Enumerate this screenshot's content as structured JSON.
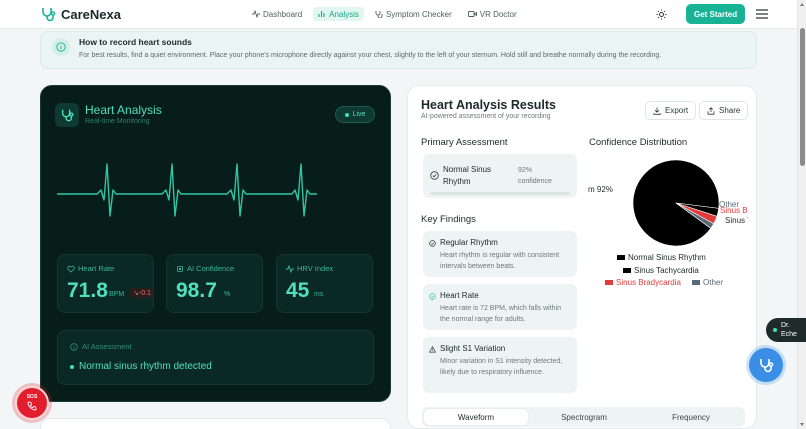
{
  "nav": {
    "brand": "CareNexa",
    "links": [
      {
        "label": "Dashboard",
        "active": false
      },
      {
        "label": "Analysis",
        "active": true
      },
      {
        "label": "Symptom Checker",
        "active": false
      },
      {
        "label": "VR Doctor",
        "active": false
      }
    ],
    "cta": "Get Started"
  },
  "tip": {
    "title": "How to record heart sounds",
    "body": "For best results, find a quiet environment. Place your phone's microphone directly against your chest, slightly to the left of your sternum. Hold still and breathe normally during the recording."
  },
  "monitor": {
    "title": "Heart Analysis",
    "subtitle": "Real-time Monitoring",
    "live": "Live",
    "stats": [
      {
        "label": "Heart Rate",
        "value": "71.8",
        "unit": "BPM",
        "delta": "-0.1"
      },
      {
        "label": "AI Confidence",
        "value": "98.7",
        "unit": "%"
      },
      {
        "label": "HRV Index",
        "value": "45",
        "unit": "ms"
      }
    ],
    "ai_label": "AI Assessment",
    "ai_result": "Normal sinus rhythm detected"
  },
  "results": {
    "title": "Heart Analysis Results",
    "subtitle": "AI-powered assessment of your recording",
    "export": "Export",
    "share": "Share",
    "primary_heading": "Primary Assessment",
    "primary_name": "Normal Sinus Rhythm",
    "primary_conf_value": "92%",
    "primary_conf_label": "confidence",
    "findings_heading": "Key Findings",
    "findings": [
      {
        "title": "Regular Rhythm",
        "body": "Heart rhythm is regular with consistent intervals between beats."
      },
      {
        "title": "Heart Rate",
        "body": "Heart rate is 72 BPM, which falls within the normal range for adults."
      },
      {
        "title": "Slight S1 Variation",
        "body": "Minor variation in S1 intensity detected, likely due to respiratory influence."
      }
    ],
    "distribution_heading": "Confidence Distribution",
    "pie_label_left": "m 92%",
    "pie_label_other": "Other",
    "pie_label_brady": "Sinus B",
    "pie_label_tachy": "Sinus T",
    "tabs": [
      "Waveform",
      "Spectrogram",
      "Frequency"
    ]
  },
  "chart_data": {
    "type": "pie",
    "title": "Confidence Distribution",
    "categories": [
      "Normal Sinus Rhythm",
      "Sinus Tachycardia",
      "Sinus Bradycardia",
      "Other"
    ],
    "values": [
      92,
      3,
      3,
      2
    ],
    "colors": [
      "#000000",
      "#000000",
      "#e23b3b",
      "#5a6a78"
    ],
    "legend_position": "bottom"
  },
  "sos": {
    "label": "SOS"
  },
  "assistant": {
    "line1": "Dr.",
    "line2": "Eche"
  }
}
